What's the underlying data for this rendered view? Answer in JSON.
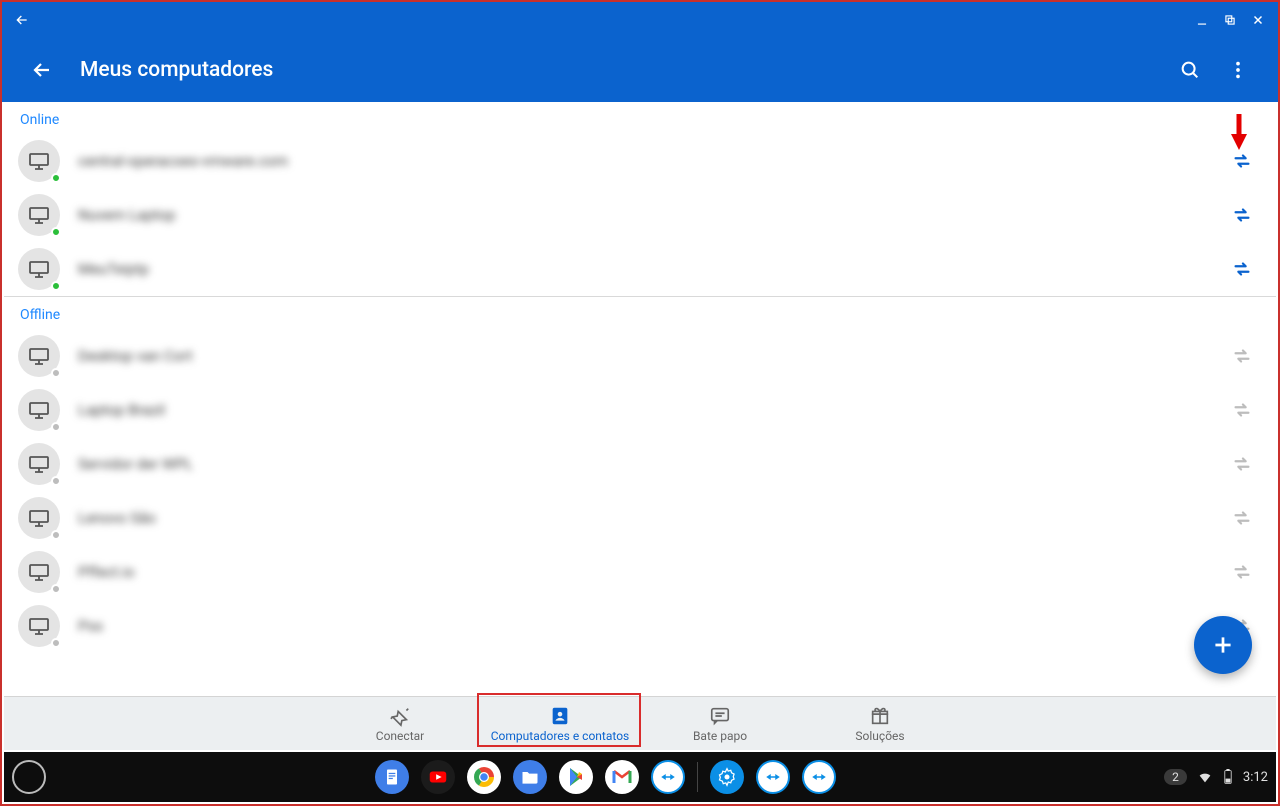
{
  "appbar": {
    "title": "Meus computadores"
  },
  "sections": {
    "online_label": "Online",
    "offline_label": "Offline"
  },
  "online": [
    {
      "name": "central-operacoes-vmware.com"
    },
    {
      "name": "Nuvem Laptop"
    },
    {
      "name": "MeuTeiptp"
    }
  ],
  "offline": [
    {
      "name": "Desktop van Cort"
    },
    {
      "name": "Laptop Brazil"
    },
    {
      "name": "Servidor der WPL"
    },
    {
      "name": "Lenovo São"
    },
    {
      "name": "Pffect.io"
    },
    {
      "name": "Pss"
    }
  ],
  "bottomnav": {
    "connect": "Conectar",
    "computers": "Computadores e contatos",
    "chat": "Bate papo",
    "solutions": "Soluções",
    "active_index": 1
  },
  "shelf": {
    "notif_count": "2",
    "time": "3:12"
  },
  "colors": {
    "primary": "#0b63ce",
    "annotation": "#d92c2c"
  }
}
